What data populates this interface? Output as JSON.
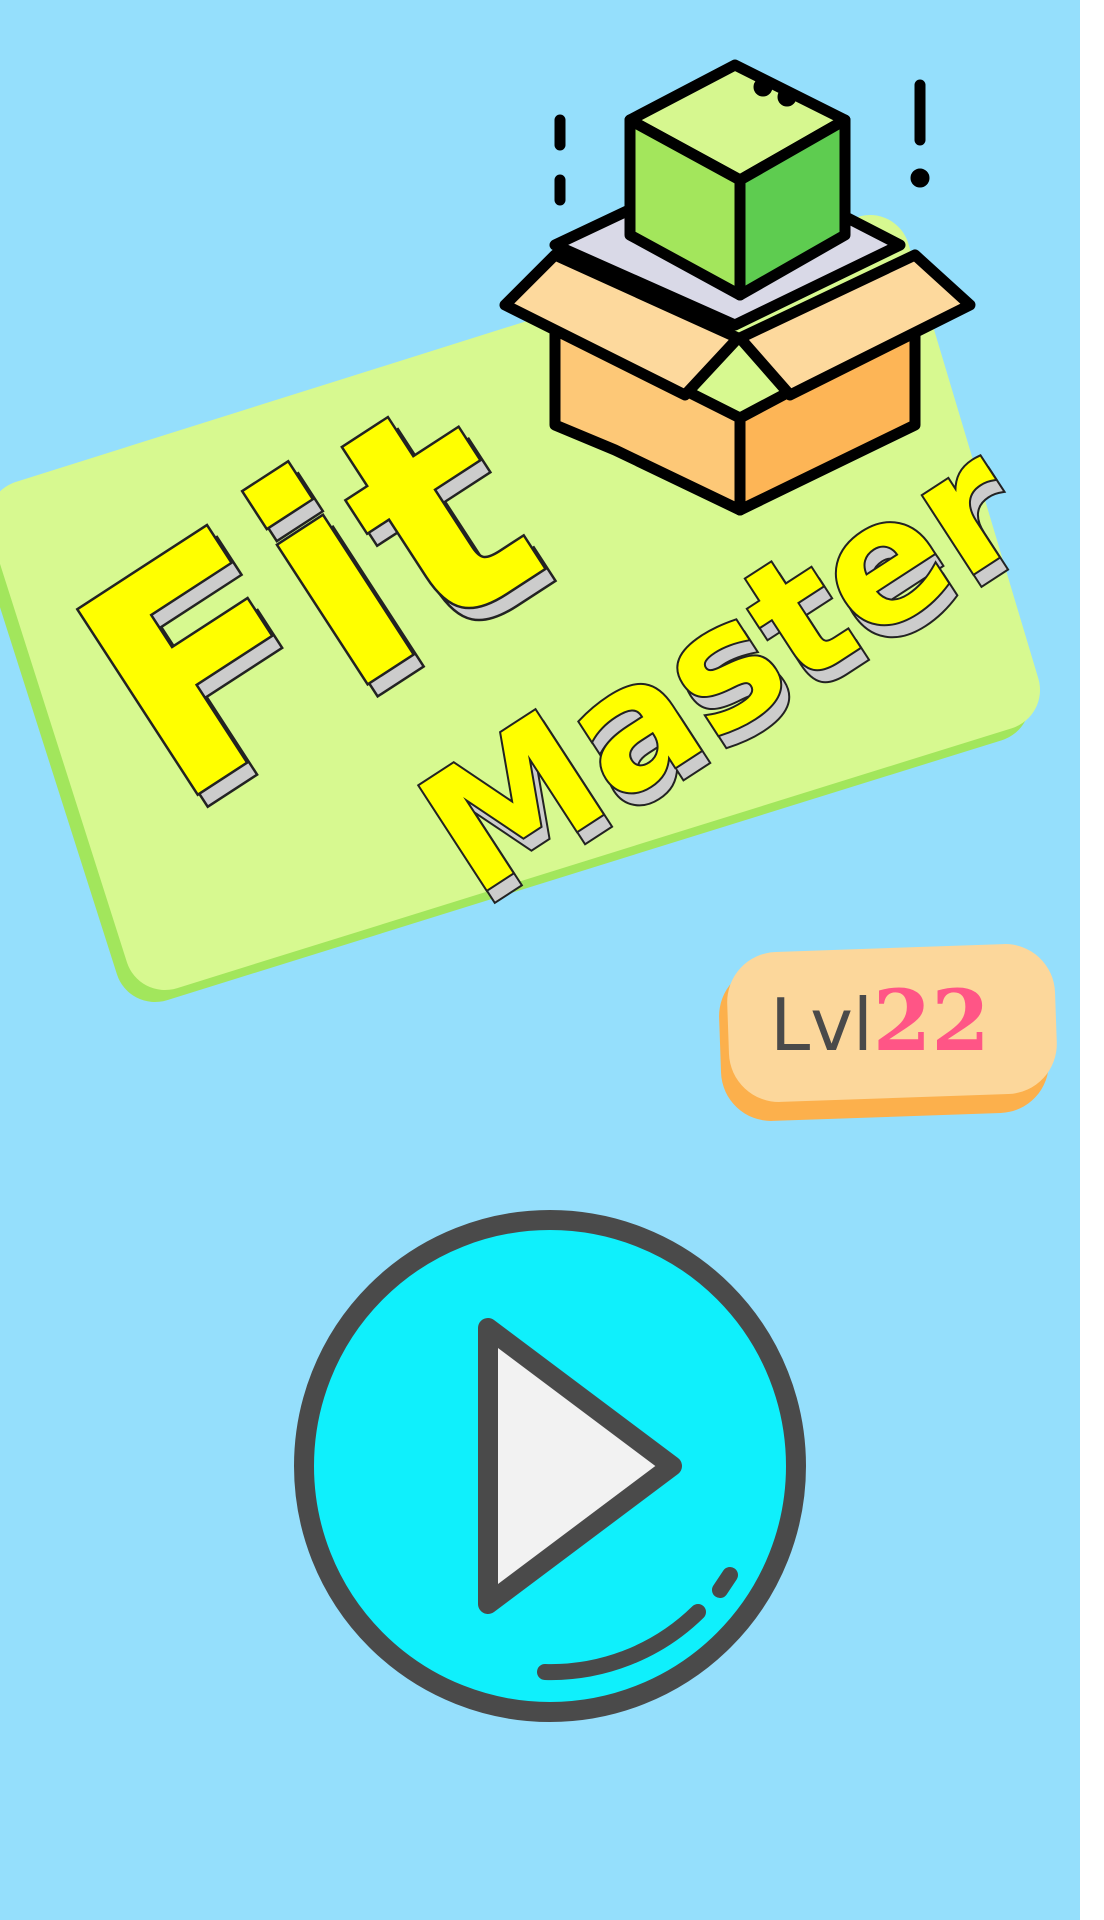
{
  "game": {
    "title_word1": "Fit",
    "title_word2": "Master",
    "level_prefix": "Lvl",
    "level_number": "22"
  },
  "icons": {
    "logo": "box-with-cube-icon",
    "play": "play-icon"
  },
  "colors": {
    "background": "#95dffc",
    "title_panel": "#d7f990",
    "title_panel_shadow": "#a2e65c",
    "title_fill": "#ffff00",
    "level_badge": "#fcd79b",
    "level_badge_shadow": "#fcb04c",
    "level_number": "#ff5586",
    "play_button": "#0ff0fc",
    "outline": "#4a4a4a"
  }
}
